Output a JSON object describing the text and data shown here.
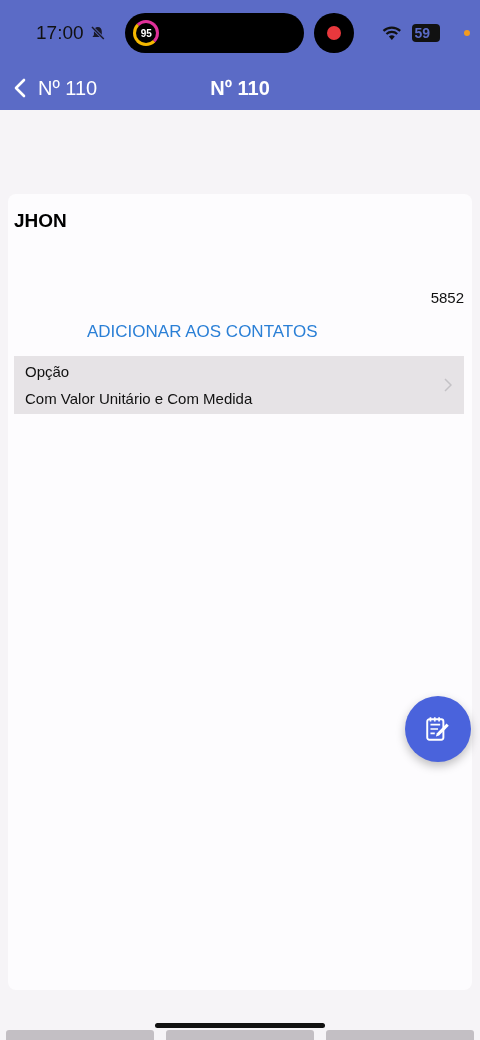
{
  "status_bar": {
    "time": "17:00",
    "activity_ring": "95",
    "battery": "59"
  },
  "nav_bar": {
    "back_label": "Nº 110",
    "title": "Nº 110"
  },
  "card": {
    "name": "JHON",
    "number": "5852",
    "link": "ADICIONAR AOS CONTATOS",
    "option": {
      "label": "Opção",
      "value": "Com Valor Unitário e Com Medida"
    }
  },
  "bottom_buttons": [
    {
      "kind": "blank"
    },
    {
      "kind": "blank"
    },
    {
      "kind": "blank"
    }
  ]
}
